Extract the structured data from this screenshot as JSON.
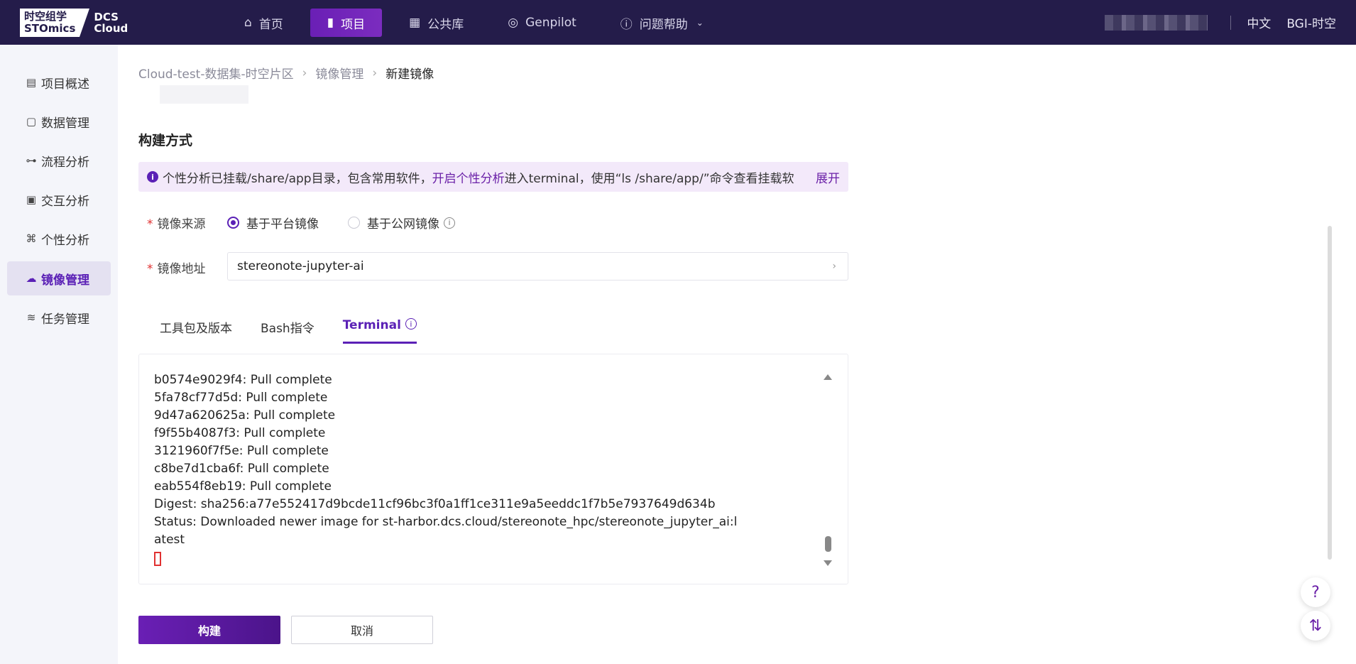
{
  "header": {
    "logo_cn": "时空组学",
    "logo_en": "STOmics",
    "logo_dcs": "DCS",
    "logo_cloud": "Cloud",
    "nav": [
      {
        "label": "首页",
        "icon": "home-icon"
      },
      {
        "label": "项目",
        "icon": "file-icon"
      },
      {
        "label": "公共库",
        "icon": "grid-icon"
      },
      {
        "label": "Genpilot",
        "icon": "aperture-icon"
      },
      {
        "label": "问题帮助",
        "icon": "question-circle-icon"
      }
    ],
    "language": "中文",
    "account": "BGI-时空"
  },
  "sidebar": {
    "items": [
      {
        "label": "项目概述",
        "icon": "document-icon"
      },
      {
        "label": "数据管理",
        "icon": "data-file-icon"
      },
      {
        "label": "流程分析",
        "icon": "flow-icon"
      },
      {
        "label": "交互分析",
        "icon": "image-icon"
      },
      {
        "label": "个性分析",
        "icon": "code-icon"
      },
      {
        "label": "镜像管理",
        "icon": "docker-icon"
      },
      {
        "label": "任务管理",
        "icon": "layers-icon"
      }
    ],
    "active_index": 5
  },
  "breadcrumb": {
    "items": [
      "Cloud-test-数据集-时空片区",
      "镜像管理",
      "新建镜像"
    ]
  },
  "section": {
    "title": "构建方式"
  },
  "notice": {
    "text_before": "个性分析已挂载/share/app目录，包含常用软件，",
    "link": "开启个性分析",
    "text_after": "进入terminal，使用“ls /share/app/”命令查看挂载软",
    "expand": "展开"
  },
  "form": {
    "source_label": "镜像来源",
    "source_options": [
      "基于平台镜像",
      "基于公网镜像"
    ],
    "source_selected": 0,
    "address_label": "镜像地址",
    "address_value": "stereonote-jupyter-ai"
  },
  "tabs": {
    "items": [
      "工具包及版本",
      "Bash指令",
      "Terminal"
    ],
    "active_index": 2
  },
  "terminal": {
    "lines": [
      "b0574e9029f4: Pull complete",
      "5fa78cf77d5d: Pull complete",
      "9d47a620625a: Pull complete",
      "f9f55b4087f3: Pull complete",
      "3121960f7f5e: Pull complete",
      "c8be7d1cba6f: Pull complete",
      "eab554f8eb19: Pull complete",
      "Digest: sha256:a77e552417d9bcde11cf96bc3f0a1ff1ce311e9a5eeddc1f7b5e7937649d634b",
      "Status: Downloaded newer image for st-harbor.dcs.cloud/stereonote_hpc/stereonote_jupyter_ai:l",
      "atest"
    ]
  },
  "actions": {
    "build": "构建",
    "cancel": "取消"
  },
  "floating": {
    "help": "?",
    "swap": "⇅"
  }
}
